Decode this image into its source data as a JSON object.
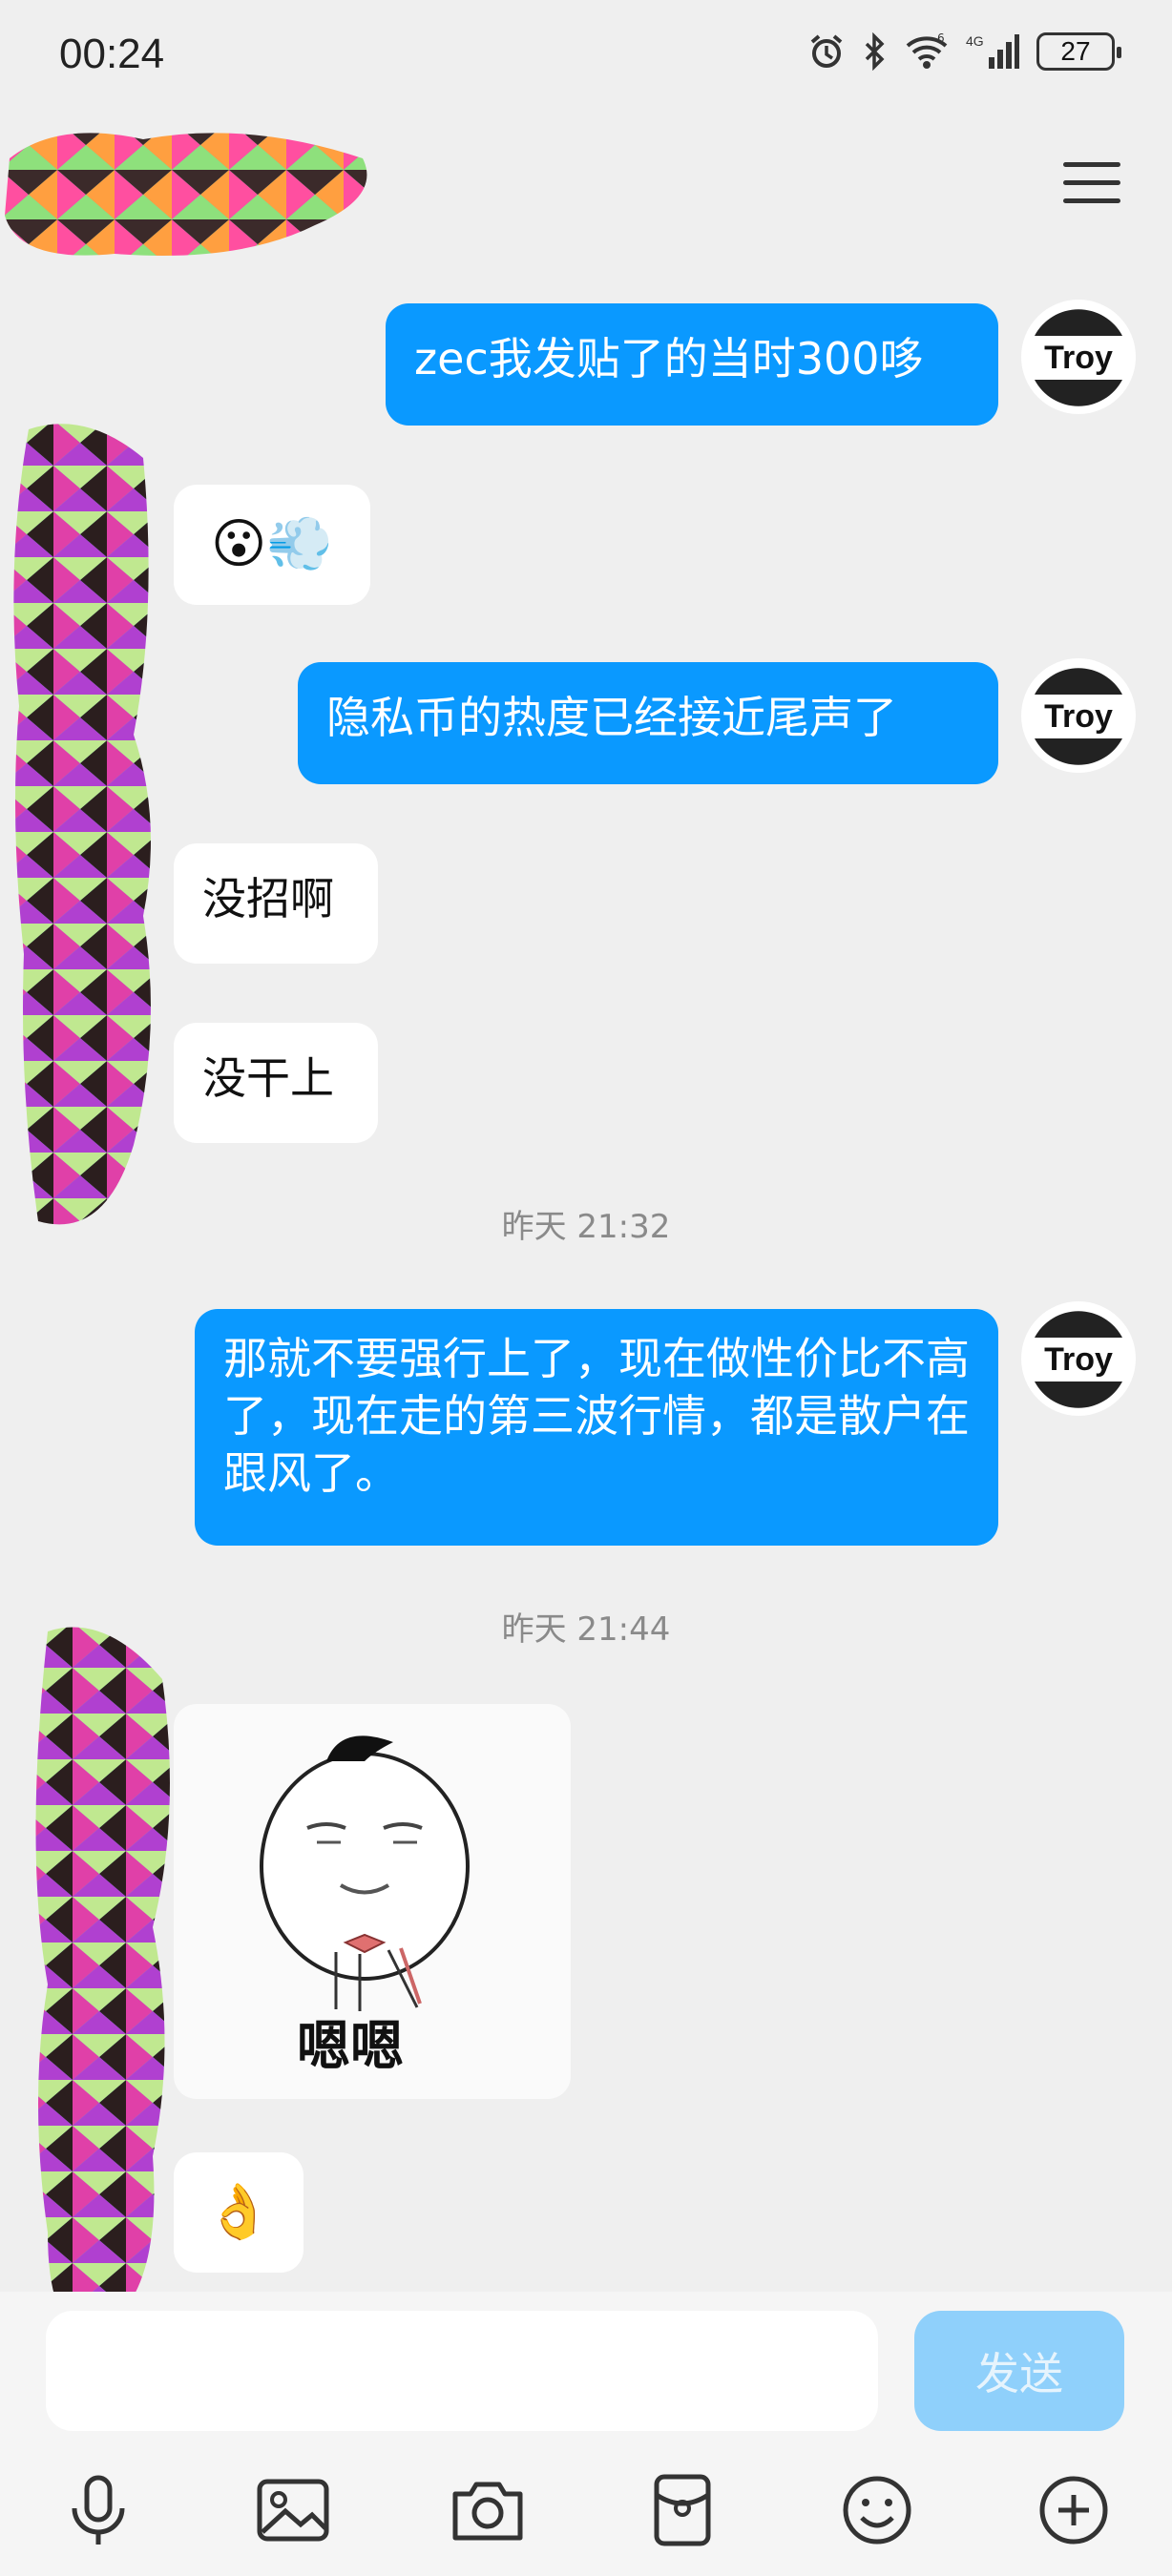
{
  "status_bar": {
    "time": "00:24",
    "battery": "27",
    "network": "4G"
  },
  "messages": [
    {
      "dir": "out",
      "text": "zec我发贴了的当时300哆"
    },
    {
      "dir": "in",
      "text": "😮💨"
    },
    {
      "dir": "out",
      "text": "隐私币的热度已经接近尾声了"
    },
    {
      "dir": "in",
      "text": "没招啊"
    },
    {
      "dir": "in",
      "text": "没干上"
    },
    {
      "dir": "out",
      "text": "那就不要强行上了，现在做性价比不高了，现在走的第三波行情，都是散户在跟风了。"
    },
    {
      "dir": "in",
      "text": "👌"
    }
  ],
  "timestamps": [
    "昨天 21:32",
    "昨天 21:44"
  ],
  "sticker": {
    "caption": "嗯嗯"
  },
  "avatar": {
    "label": "Troy"
  },
  "composer": {
    "send_label": "发送"
  },
  "toolbar": [
    "microphone-icon",
    "image-icon",
    "camera-icon",
    "red-packet-icon",
    "emoji-icon",
    "plus-icon"
  ],
  "colors": {
    "outgoing_bubble": "#0a99ff",
    "incoming_bubble": "#ffffff",
    "send_button": "#8fd0fb"
  }
}
